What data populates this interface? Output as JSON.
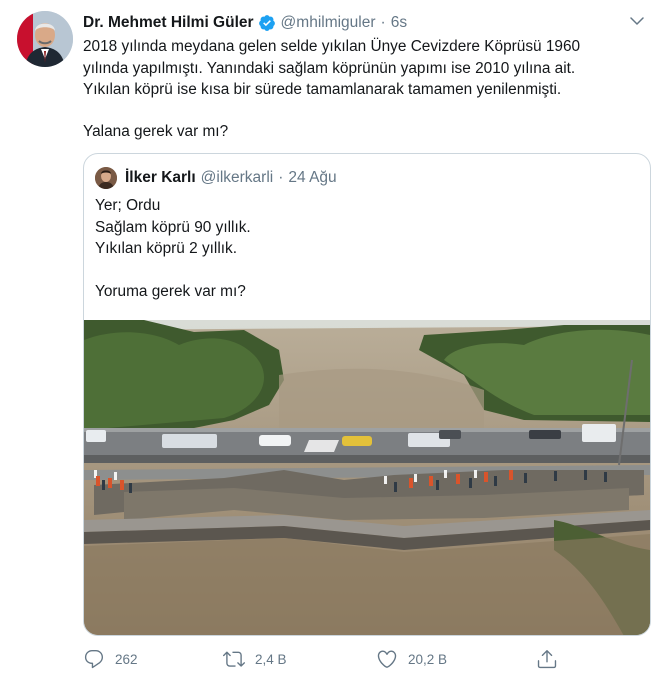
{
  "tweet": {
    "display_name": "Dr. Mehmet Hilmi Güler",
    "handle": "@mhilmiguler",
    "separator": "·",
    "time": "6s",
    "lines": [
      "2018 yılında meydana gelen selde yıkılan Ünye Cevizdere Köprüsü 1960",
      "yılında yapılmıştı. Yanındaki sağlam köprünün yapımı ise 2010 yılına ait.",
      "Yıkılan köprü ise kısa bir sürede tamamlanarak tamamen yenilenmişti."
    ],
    "last_line": "Yalana gerek var mı?"
  },
  "quoted": {
    "display_name": "İlker Karlı",
    "handle": "@ilkerkarli",
    "separator": "·",
    "date": "24 Ağu",
    "lines": [
      "Yer; Ordu",
      "Sağlam köprü 90 yıllık.",
      "Yıkılan köprü 2 yıllık."
    ],
    "last_line": "Yoruma gerek var mı?"
  },
  "actions": {
    "reply_count": "262",
    "retweet_count": "2,4 B",
    "like_count": "20,2 B"
  },
  "icons": {
    "verified": "verified-badge-icon",
    "caret": "chevron-down-icon",
    "reply": "reply-icon",
    "retweet": "retweet-icon",
    "like": "heart-icon",
    "share": "share-icon"
  },
  "colors": {
    "accent": "#1da1f2",
    "muted": "#657786",
    "border": "#ccd6dd",
    "text": "#14171a"
  }
}
